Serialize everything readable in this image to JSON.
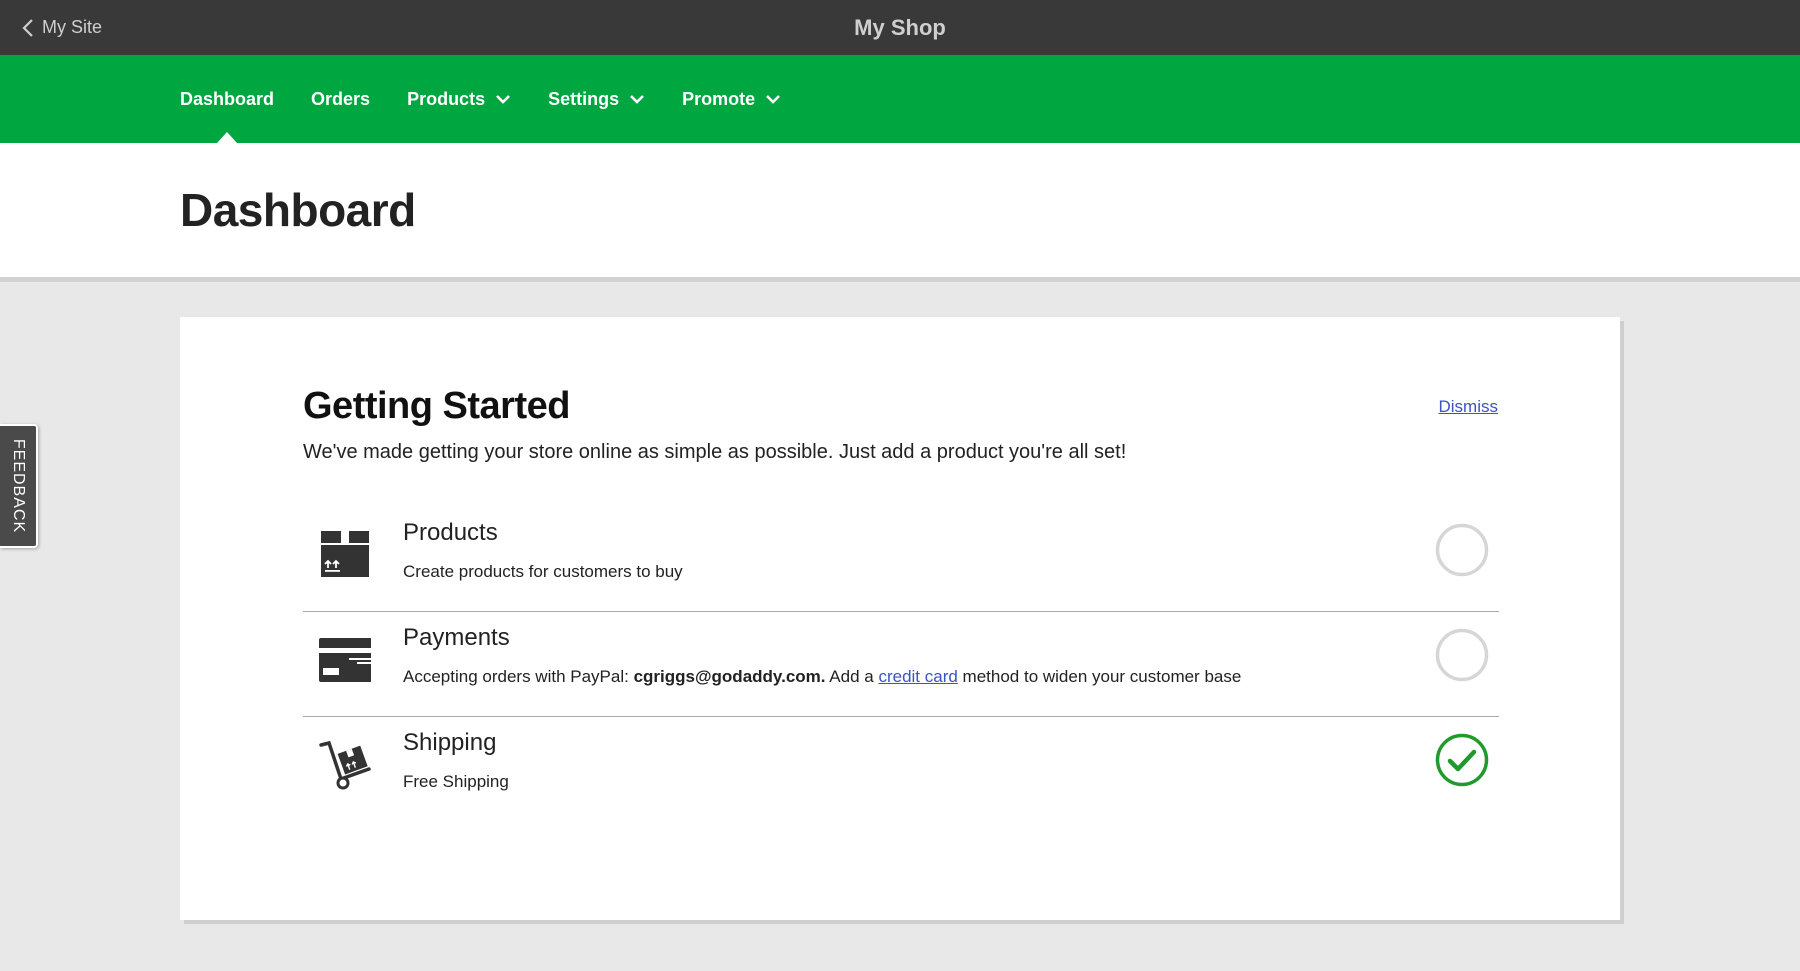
{
  "topbar": {
    "back_label": "My Site",
    "site_title": "My Shop"
  },
  "nav": {
    "items": [
      {
        "label": "Dashboard",
        "active": true,
        "dropdown": false
      },
      {
        "label": "Orders",
        "active": false,
        "dropdown": false
      },
      {
        "label": "Products",
        "active": false,
        "dropdown": true
      },
      {
        "label": "Settings",
        "active": false,
        "dropdown": true
      },
      {
        "label": "Promote",
        "active": false,
        "dropdown": true
      }
    ]
  },
  "page": {
    "title": "Dashboard"
  },
  "getting_started": {
    "title": "Getting Started",
    "dismiss_label": "Dismiss",
    "subtitle": "We've made getting your store online as simple as possible. Just add a product you're all set!",
    "tasks": [
      {
        "icon": "package-icon",
        "title": "Products",
        "description": "Create products for customers to buy",
        "complete": false
      },
      {
        "icon": "credit-card-icon",
        "title": "Payments",
        "description_prefix": "Accepting orders with PayPal: ",
        "description_email": "cgriggs@godaddy.com.",
        "description_mid": " Add a ",
        "description_link": "credit card",
        "description_suffix": " method to widen your customer base",
        "complete": false
      },
      {
        "icon": "hand-truck-icon",
        "title": "Shipping",
        "description": "Free Shipping",
        "complete": true
      }
    ]
  },
  "feedback": {
    "label": "FEEDBACK"
  },
  "colors": {
    "topbar": "#393939",
    "nav_green": "#00a63f",
    "complete_green": "#1f9a2b",
    "link_blue": "#3b53c4",
    "incomplete_ring": "#d6d6d6"
  }
}
